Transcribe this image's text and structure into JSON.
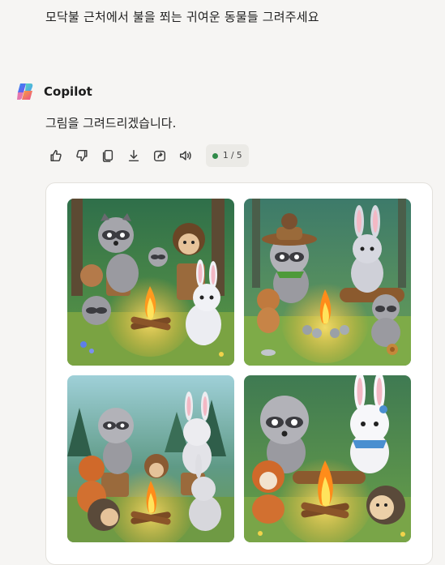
{
  "conversation": {
    "user_message": "모닥불 근처에서 불을 쬐는 귀여운 동물들 그려주세요",
    "assistant": {
      "name": "Copilot",
      "reply": "그림을 그려드리겠습니다.",
      "actions": [
        {
          "icon": "thumbs-up-icon"
        },
        {
          "icon": "thumbs-down-icon"
        },
        {
          "icon": "copy-icon"
        },
        {
          "icon": "download-icon"
        },
        {
          "icon": "share-icon"
        },
        {
          "icon": "speaker-icon"
        }
      ],
      "page_indicator": "1 / 5",
      "indicator_color": "#2f8a48"
    },
    "images": [
      {
        "icon": "generated-image-raccoons-hedgehog-bunny"
      },
      {
        "icon": "generated-image-raccoon-hat-bunny"
      },
      {
        "icon": "generated-image-hedgehog-fox-bunny"
      },
      {
        "icon": "generated-image-raccoon-bunny-fox"
      }
    ]
  },
  "colors": {
    "background": "#f6f5f3",
    "card": "#ffffff"
  }
}
